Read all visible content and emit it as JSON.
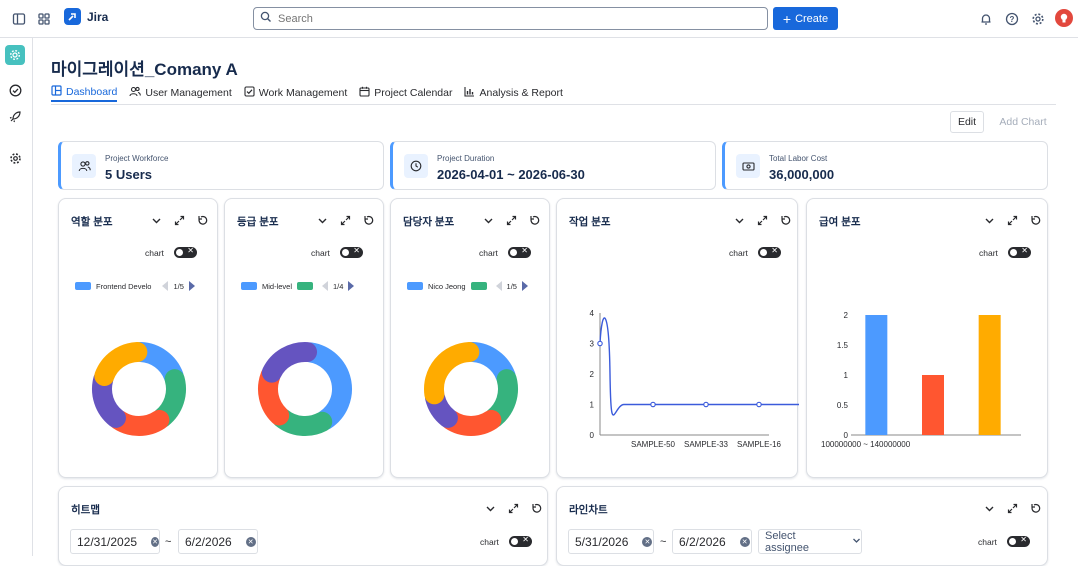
{
  "topbar": {
    "app_name": "Jira",
    "search_placeholder": "Search",
    "create_label": "Create"
  },
  "page": {
    "title": "마이그레이션_Comany A",
    "tabs": [
      {
        "label": "Dashboard",
        "icon": "dashboard-icon",
        "active": true
      },
      {
        "label": "User Management",
        "icon": "users-icon"
      },
      {
        "label": "Work Management",
        "icon": "checkbox-icon"
      },
      {
        "label": "Project Calendar",
        "icon": "calendar-icon"
      },
      {
        "label": "Analysis & Report",
        "icon": "bar-chart-icon"
      }
    ],
    "edit_label": "Edit",
    "add_chart_label": "Add Chart"
  },
  "stats": [
    {
      "label": "Project Workforce",
      "value": "5 Users",
      "icon": "users-icon"
    },
    {
      "label": "Project Duration",
      "value": "2026-04-01 ~ 2026-06-30",
      "icon": "clock-icon"
    },
    {
      "label": "Total Labor Cost",
      "value": "36,000,000",
      "icon": "money-icon"
    }
  ],
  "cards": {
    "role": {
      "title": "역할 분포",
      "toggle_label": "chart",
      "legend_label": "Frontend Develo",
      "page": "1/5"
    },
    "grade": {
      "title": "등급 분포",
      "toggle_label": "chart",
      "legend_label": "Mid-level",
      "page": "1/4"
    },
    "assignee": {
      "title": "담당자 분포",
      "toggle_label": "chart",
      "legend_label": "Nico Jeong",
      "page": "1/5"
    },
    "task": {
      "title": "작업 분포",
      "toggle_label": "chart"
    },
    "salary": {
      "title": "급여 분포",
      "toggle_label": "chart"
    },
    "heatmap": {
      "title": "히트맵",
      "toggle_label": "chart",
      "start_date": "12/31/2025",
      "end_date": "6/2/2026",
      "tilde": "~"
    },
    "linechart": {
      "title": "라인차트",
      "toggle_label": "chart",
      "start_date": "5/31/2026",
      "end_date": "6/2/2026",
      "tilde": "~",
      "assignee_placeholder": "Select assignee"
    }
  },
  "colors": {
    "blue": "#4c9aff",
    "green": "#36b37e",
    "red": "#ff5630",
    "purple": "#6554c0",
    "yellow": "#ffab00",
    "brand": "#1868db"
  },
  "chart_data": [
    {
      "type": "pie",
      "title": "역할 분포",
      "slices": [
        {
          "color": "#4c9aff",
          "value": 1
        },
        {
          "color": "#36b37e",
          "value": 1
        },
        {
          "color": "#ff5630",
          "value": 1
        },
        {
          "color": "#6554c0",
          "value": 1
        },
        {
          "color": "#ffab00",
          "value": 1
        }
      ]
    },
    {
      "type": "pie",
      "title": "등급 분포",
      "slices": [
        {
          "color": "#4c9aff",
          "value": 2
        },
        {
          "color": "#36b37e",
          "value": 1
        },
        {
          "color": "#ff5630",
          "value": 1
        },
        {
          "color": "#6554c0",
          "value": 1
        }
      ]
    },
    {
      "type": "pie",
      "title": "담당자 분포",
      "slices": [
        {
          "color": "#4c9aff",
          "value": 1
        },
        {
          "color": "#36b37e",
          "value": 1
        },
        {
          "color": "#ff5630",
          "value": 1
        },
        {
          "color": "#6554c0",
          "value": 0.6
        },
        {
          "color": "#ffab00",
          "value": 1.4
        }
      ]
    },
    {
      "type": "line",
      "title": "작업 분포",
      "x": [
        "",
        "SAMPLE-50",
        "SAMPLE-33",
        "SAMPLE-16"
      ],
      "values": [
        3,
        1,
        1,
        1
      ],
      "ylim": [
        0,
        4
      ],
      "yticks": [
        "0",
        "1",
        "2",
        "3",
        "4"
      ]
    },
    {
      "type": "bar",
      "title": "급여 분포",
      "categories": [
        "100000000 ~ 140000000",
        "",
        ""
      ],
      "values": [
        2,
        1,
        2
      ],
      "bar_colors": [
        "#4c9aff",
        "#ff5630",
        "#ffab00"
      ],
      "ylim": [
        0,
        2
      ],
      "yticks": [
        "0",
        "0.5",
        "1",
        "1.5",
        "2"
      ]
    }
  ]
}
